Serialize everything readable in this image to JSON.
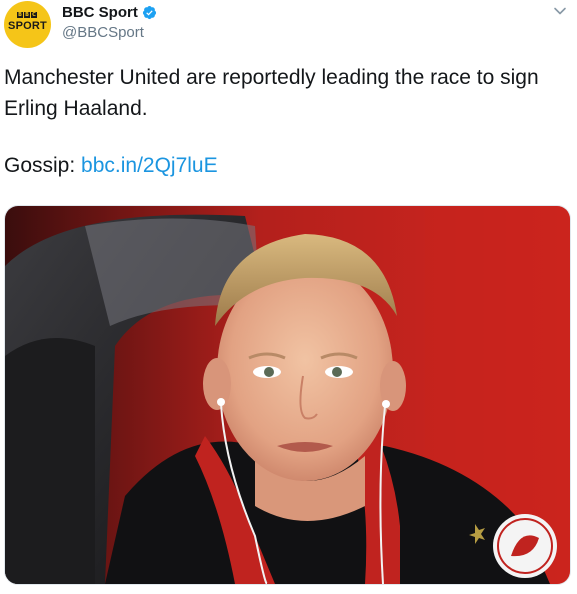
{
  "account": {
    "avatar_bbc_letters": [
      "B",
      "B",
      "C"
    ],
    "avatar_label": "SPORT",
    "display_name": "BBC Sport",
    "handle": "@BBCSport",
    "verified": true
  },
  "tweet": {
    "text": "Manchester United are reportedly leading the race to sign Erling Haaland.",
    "gossip_label": "Gossip: ",
    "link": "bbc.in/2Qj7luE"
  },
  "colors": {
    "accent": "#1b95e0",
    "brand_yellow": "#f5c518",
    "text": "#14171a",
    "muted": "#657786"
  },
  "icons": {
    "verified": "verified-badge-icon",
    "menu": "chevron-down-icon"
  }
}
